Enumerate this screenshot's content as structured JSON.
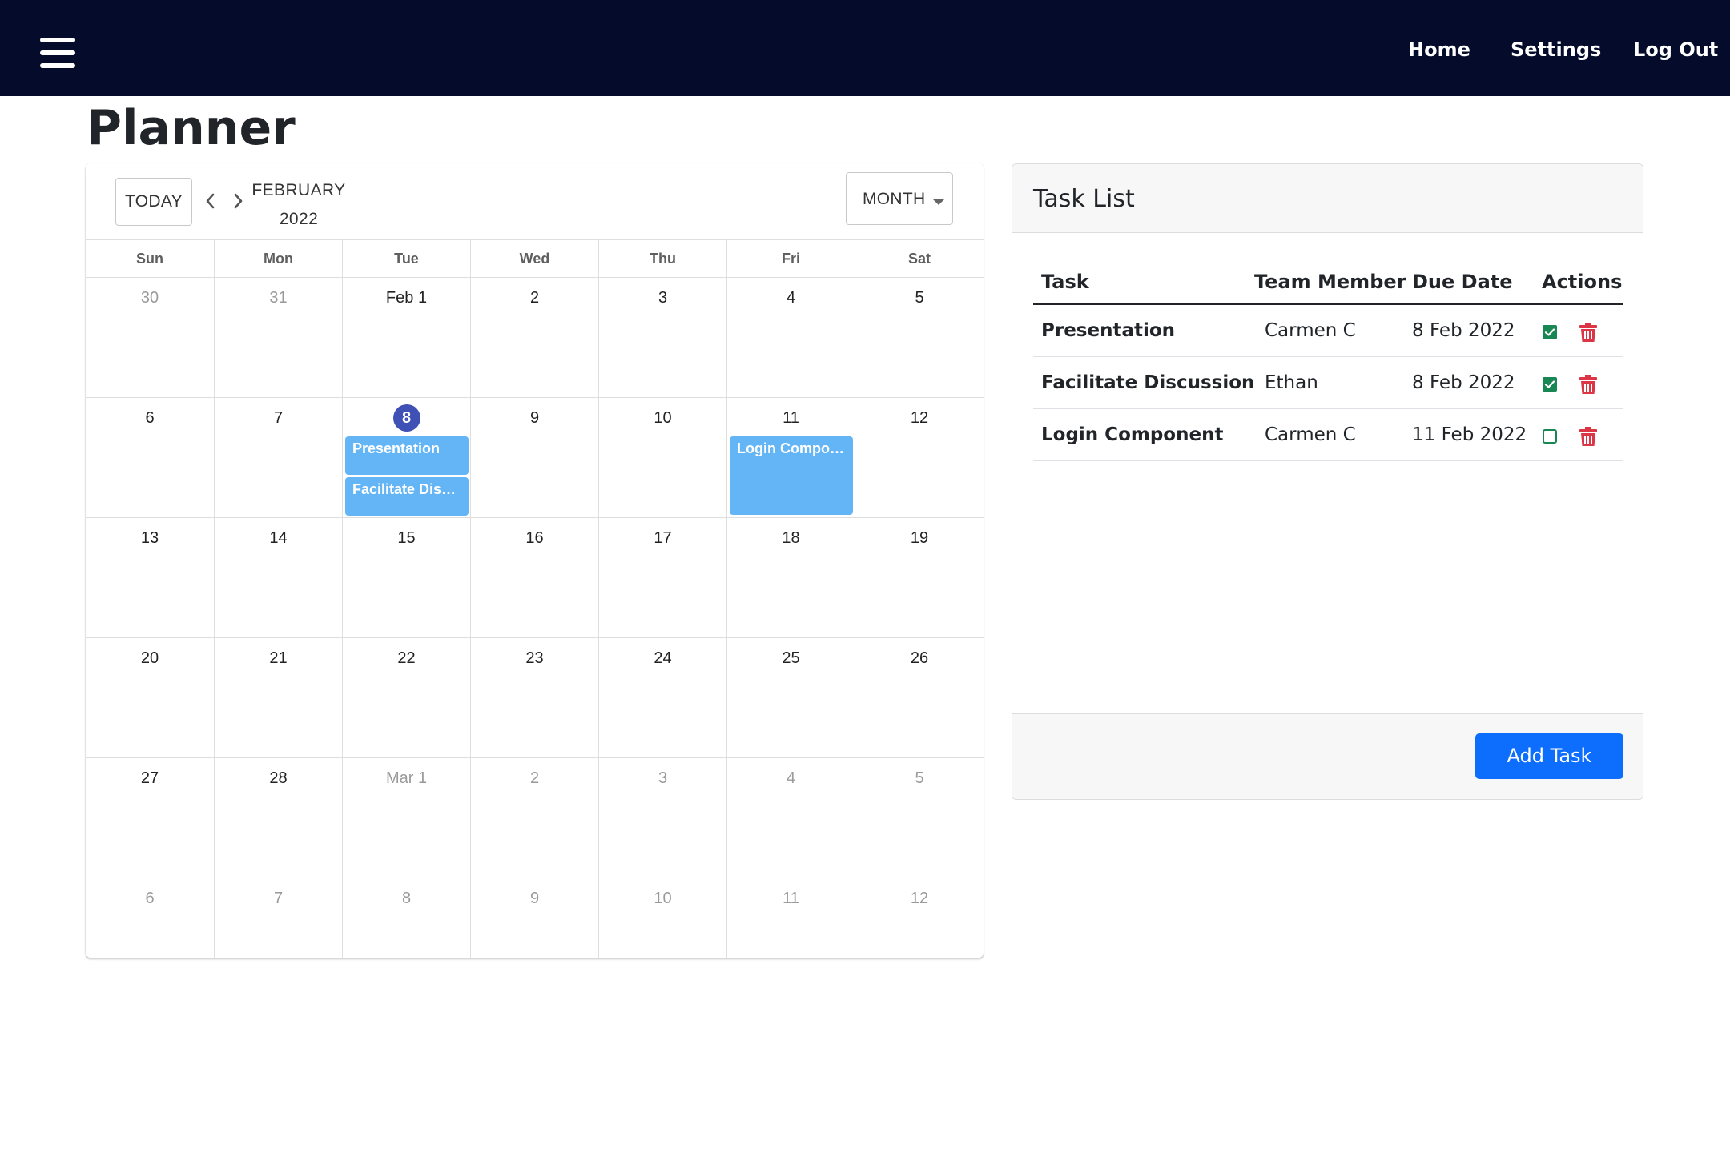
{
  "nav": {
    "links": [
      {
        "label": "Home"
      },
      {
        "label": "Settings"
      },
      {
        "label": "Log Out"
      }
    ]
  },
  "page": {
    "title": "Planner"
  },
  "calendar": {
    "today_label": "TODAY",
    "month_label": "FEBRUARY",
    "year_label": "2022",
    "view_label": "MONTH",
    "days_of_week": [
      "Sun",
      "Mon",
      "Tue",
      "Wed",
      "Thu",
      "Fri",
      "Sat"
    ],
    "today_color": "#3f51b5",
    "event_color": "#64b5f6",
    "weeks": [
      [
        {
          "label": "30",
          "muted": true
        },
        {
          "label": "31",
          "muted": true
        },
        {
          "label": "Feb 1"
        },
        {
          "label": "2"
        },
        {
          "label": "3"
        },
        {
          "label": "4"
        },
        {
          "label": "5"
        }
      ],
      [
        {
          "label": "6"
        },
        {
          "label": "7"
        },
        {
          "label": "8",
          "today": true,
          "events": [
            {
              "title": "Presentation"
            },
            {
              "title": "Facilitate Discussion"
            }
          ]
        },
        {
          "label": "9"
        },
        {
          "label": "10"
        },
        {
          "label": "11",
          "events": [
            {
              "title": "Login Component",
              "tall": true
            }
          ]
        },
        {
          "label": "12"
        }
      ],
      [
        {
          "label": "13"
        },
        {
          "label": "14"
        },
        {
          "label": "15"
        },
        {
          "label": "16"
        },
        {
          "label": "17"
        },
        {
          "label": "18"
        },
        {
          "label": "19"
        }
      ],
      [
        {
          "label": "20"
        },
        {
          "label": "21"
        },
        {
          "label": "22"
        },
        {
          "label": "23"
        },
        {
          "label": "24"
        },
        {
          "label": "25"
        },
        {
          "label": "26"
        }
      ],
      [
        {
          "label": "27"
        },
        {
          "label": "28"
        },
        {
          "label": "Mar 1",
          "muted": true
        },
        {
          "label": "2",
          "muted": true
        },
        {
          "label": "3",
          "muted": true
        },
        {
          "label": "4",
          "muted": true
        },
        {
          "label": "5",
          "muted": true
        }
      ],
      [
        {
          "label": "6",
          "muted": true
        },
        {
          "label": "7",
          "muted": true
        },
        {
          "label": "8",
          "muted": true
        },
        {
          "label": "9",
          "muted": true
        },
        {
          "label": "10",
          "muted": true
        },
        {
          "label": "11",
          "muted": true
        },
        {
          "label": "12",
          "muted": true
        }
      ]
    ]
  },
  "tasks": {
    "title": "Task List",
    "columns": [
      "Task",
      "Team Member",
      "Due Date",
      "Actions"
    ],
    "rows": [
      {
        "task": "Presentation",
        "member": "Carmen C",
        "due": "8 Feb 2022",
        "done": true
      },
      {
        "task": "Facilitate Discussion",
        "member": "Ethan",
        "due": "8 Feb 2022",
        "done": true
      },
      {
        "task": "Login Component",
        "member": "Carmen C",
        "due": "11 Feb 2022",
        "done": false
      }
    ],
    "add_label": "Add Task",
    "check_color": "#198754",
    "delete_color": "#dc3545",
    "button_color": "#0d6efd"
  }
}
